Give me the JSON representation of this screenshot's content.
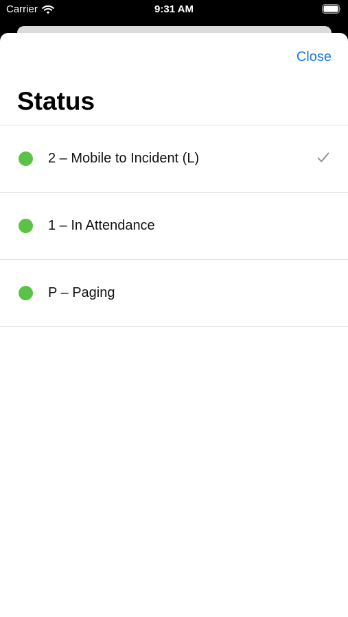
{
  "status_bar": {
    "carrier": "Carrier",
    "time": "9:31 AM"
  },
  "sheet": {
    "close_label": "Close",
    "title": "Status"
  },
  "status_items": [
    {
      "label": "2 – Mobile to Incident (L)",
      "selected": true,
      "dot_color": "#5ac244"
    },
    {
      "label": "1 – In Attendance",
      "selected": false,
      "dot_color": "#5ac244"
    },
    {
      "label": "P – Paging",
      "selected": false,
      "dot_color": "#5ac244"
    }
  ],
  "colors": {
    "accent": "#1a7ae4",
    "status_green": "#5ac244"
  },
  "icons": {
    "selected_indicator": "checkmark-icon",
    "network": "wifi-icon",
    "power": "battery-icon"
  }
}
